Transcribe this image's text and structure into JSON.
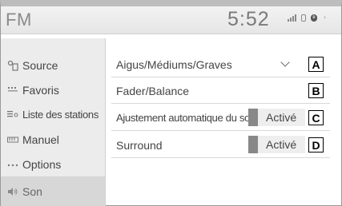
{
  "header": {
    "title": "FM",
    "time": "5:52",
    "icons": [
      "signal-icon",
      "phone-battery-icon",
      "bluetooth-icon",
      "wifi-icon"
    ]
  },
  "sidebar": {
    "items": [
      {
        "label": "Source",
        "icon": "source-icon"
      },
      {
        "label": "Favoris",
        "icon": "favorites-icon"
      },
      {
        "label": "Liste des stations",
        "icon": "station-list-icon"
      },
      {
        "label": "Manuel",
        "icon": "manual-icon"
      },
      {
        "label": "Options",
        "icon": "options-icon"
      },
      {
        "label": "Son",
        "icon": "speaker-icon",
        "active": true
      }
    ]
  },
  "settings": {
    "rows": [
      {
        "label": "Aigus/Médiums/Graves",
        "callout": "A",
        "control": "chevron"
      },
      {
        "label": "Fader/Balance",
        "callout": "B",
        "control": "none"
      },
      {
        "label": "Ajustement automatique du son",
        "callout": "C",
        "control": "toggle",
        "value": "Activé"
      },
      {
        "label": "Surround",
        "callout": "D",
        "control": "toggle",
        "value": "Activé"
      }
    ]
  }
}
